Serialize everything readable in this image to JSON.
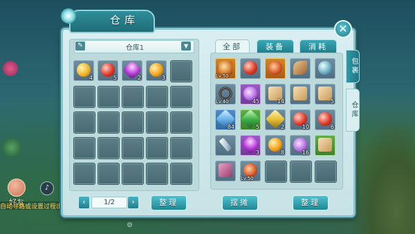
{
  "window": {
    "title": "仓库"
  },
  "hud": {
    "friend_label": "好友",
    "auto_path_text": "自动寻路或设置过程出"
  },
  "storage": {
    "selector_label": "仓库1",
    "items": [
      {
        "count": "4",
        "icon": "gold-ingot-icon"
      },
      {
        "count": "5",
        "icon": "red-orb-icon"
      },
      {
        "count": "2",
        "icon": "purple-gem-icon"
      },
      {
        "count": "3",
        "icon": "gold-swirl-icon"
      }
    ],
    "page": "1/2",
    "sort_label": "整理"
  },
  "inventory": {
    "tabs": [
      "全部",
      "装备",
      "消耗"
    ],
    "side_tabs": [
      "包裹",
      "仓库"
    ],
    "items": [
      {
        "lv": "Lv.50",
        "count": "",
        "icon": "armor-icon",
        "rarity": "orange"
      },
      {
        "lv": "",
        "count": "",
        "icon": "red-pouch-icon",
        "rarity": "default"
      },
      {
        "lv": "",
        "count": "",
        "icon": "dragon-helmet-icon",
        "rarity": "orange"
      },
      {
        "lv": "",
        "count": "",
        "icon": "feather-icon",
        "rarity": "default"
      },
      {
        "lv": "",
        "count": "",
        "icon": "blue-pill-icon",
        "rarity": "default"
      },
      {
        "lv": "Lv.40",
        "count": "",
        "icon": "ring-icon",
        "rarity": "default"
      },
      {
        "lv": "",
        "count": "45",
        "icon": "purple-wing-icon",
        "rarity": "purple"
      },
      {
        "lv": "",
        "count": "14",
        "icon": "scroll-icon",
        "rarity": "default"
      },
      {
        "lv": "",
        "count": "",
        "icon": "scroll-icon",
        "rarity": "default"
      },
      {
        "lv": "",
        "count": "5",
        "icon": "scroll-icon",
        "rarity": "default"
      },
      {
        "lv": "",
        "count": "84",
        "icon": "blue-crystal-icon",
        "rarity": "blue"
      },
      {
        "lv": "",
        "count": "5",
        "icon": "green-crystal-icon",
        "rarity": "green"
      },
      {
        "lv": "",
        "count": "2",
        "icon": "yellow-crystal-icon",
        "rarity": "default"
      },
      {
        "lv": "",
        "count": "10",
        "icon": "red-orb-icon",
        "rarity": "default"
      },
      {
        "lv": "",
        "count": "6",
        "icon": "red-orb-icon",
        "rarity": "default"
      },
      {
        "lv": "",
        "count": "",
        "icon": "silver-key-icon",
        "rarity": "default"
      },
      {
        "lv": "",
        "count": "3",
        "icon": "purple-gem-icon",
        "rarity": "purple"
      },
      {
        "lv": "",
        "count": "8",
        "icon": "gold-swirl-icon",
        "rarity": "default"
      },
      {
        "lv": "",
        "count": "16",
        "icon": "purple-wing-icon",
        "rarity": "default"
      },
      {
        "lv": "",
        "count": "",
        "icon": "green-scroll-icon",
        "rarity": "green"
      },
      {
        "lv": "",
        "count": "",
        "icon": "book-icon",
        "rarity": "default"
      },
      {
        "lv": "Lv.50",
        "count": "",
        "icon": "dragon-helmet-icon",
        "rarity": "default"
      }
    ],
    "stall_label": "摆摊",
    "sort_label": "整理"
  }
}
